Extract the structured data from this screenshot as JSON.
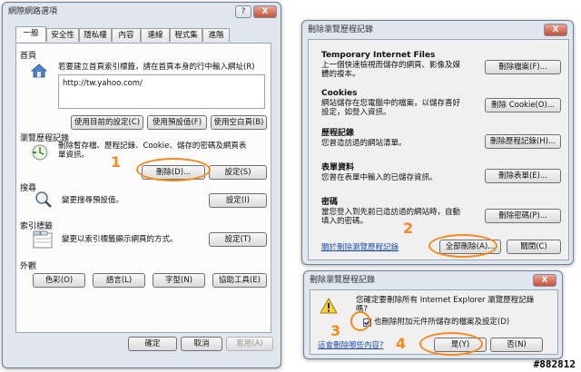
{
  "main_window": {
    "title": "網際網路選項",
    "help_btn": "?",
    "close_btn": "X",
    "tabs": [
      "一般",
      "安全性",
      "隱私權",
      "內容",
      "連線",
      "程式集",
      "進階"
    ],
    "homepage": {
      "heading": "首頁",
      "desc": "若要建立首頁索引標籤，請在首頁本身的行中輸入網址(R)",
      "url": "http://tw.yahoo.com/",
      "btn_current": "使用目前的設定(C)",
      "btn_default": "使用預設值(F)",
      "btn_blank": "使用空白頁(B)"
    },
    "history": {
      "heading": "瀏覽歷程記錄",
      "desc_line1": "刪除暫存檔、歷程記錄、Cookie、儲存的密碼及網頁表",
      "desc_line2": "單資訊。",
      "btn_delete": "刪除(D)...",
      "btn_settings": "設定(S)"
    },
    "search": {
      "heading": "搜尋",
      "desc": "變更搜尋預設值。",
      "btn_settings": "設定(I)"
    },
    "tabs_section": {
      "heading": "索引標籤",
      "desc": "變更以索引標籤顯示網頁的方式。",
      "btn_settings": "設定(T)"
    },
    "appearance": {
      "heading": "外觀",
      "btn_colors": "色彩(O)",
      "btn_languages": "語言(L)",
      "btn_fonts": "字型(N)",
      "btn_accessibility": "協助工具(E)"
    },
    "footer": {
      "ok": "確定",
      "cancel": "取消",
      "apply": "套用(A)"
    }
  },
  "delete_history_window": {
    "title": "刪除瀏覽歷程記錄",
    "close_btn": "X",
    "items": [
      {
        "title": "Temporary Internet Files",
        "desc1": "上一個快速檢視而儲存的網頁、影像及媒",
        "desc2": "體的複本。",
        "button": "刪除檔案(F)..."
      },
      {
        "title": "Cookies",
        "desc1": "網站儲存在您電腦中的檔案，以儲存喜好",
        "desc2": "設定，如登入資訊。",
        "button": "刪除 Cookie(O)..."
      },
      {
        "title": "歷程記錄",
        "desc1": "您曾造訪過的網站清單。",
        "desc2": "",
        "button": "刪除歷程記錄(H)..."
      },
      {
        "title": "表單資料",
        "desc1": "您曾在表單中輸入的已儲存資訊。",
        "desc2": "",
        "button": "刪除表單(E)..."
      },
      {
        "title": "密碼",
        "desc1": "當您登入到先前已造訪過的網站時，自動",
        "desc2": "填入的密碼。",
        "button": "刪除密碼(P)..."
      }
    ],
    "about_link": "關於刪除瀏覽歷程記錄",
    "btn_delete_all": "全部刪除(A)...",
    "btn_close": "關閉(C)"
  },
  "confirm_window": {
    "title": "刪除瀏覽歷程記錄",
    "close_btn": "X",
    "message1": "您確定要刪除所有 Internet Explorer 瀏覽歷程記錄",
    "message2": "嗎?",
    "checkbox_label": "也刪除附加元件所儲存的檔案及設定(D)",
    "link": "這會刪除哪些內容?",
    "btn_yes": "是(Y)",
    "btn_no": "否(N)"
  },
  "annotations": [
    "1",
    "2",
    "3",
    "4"
  ],
  "watermark": "#882812",
  "colors": {
    "annotation": "#f28a1e",
    "link": "#1f4fae",
    "dialog_bg": "#f0f0f0"
  }
}
